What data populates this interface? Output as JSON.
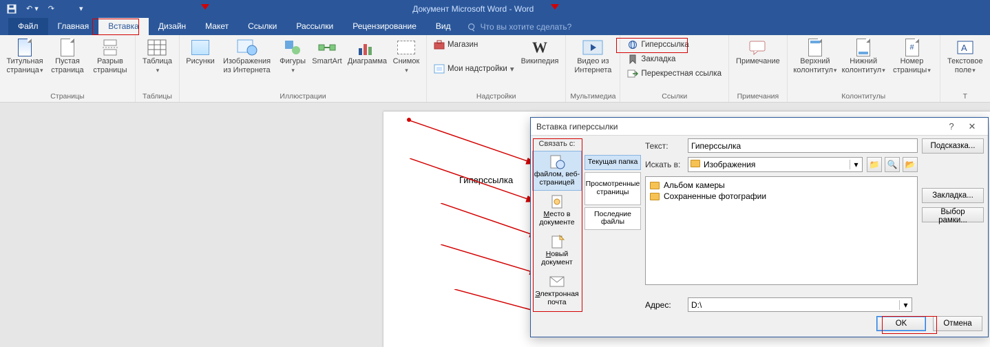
{
  "title": "Документ Microsoft Word - Word",
  "tabs": {
    "file": "Файл",
    "home": "Главная",
    "insert": "Вставка",
    "design": "Дизайн",
    "layout": "Макет",
    "references": "Ссылки",
    "mailings": "Рассылки",
    "review": "Рецензирование",
    "view": "Вид",
    "tellme": "Что вы хотите сделать?"
  },
  "ribbon": {
    "pages": {
      "label": "Страницы",
      "cover": "Титульная страница",
      "blank": "Пустая страница",
      "break": "Разрыв страницы"
    },
    "tables": {
      "label": "Таблицы",
      "table": "Таблица"
    },
    "illustrations": {
      "label": "Иллюстрации",
      "pictures": "Рисунки",
      "online": "Изображения из Интернета",
      "shapes": "Фигуры",
      "smartart": "SmartArt",
      "chart": "Диаграмма",
      "screenshot": "Снимок"
    },
    "addins": {
      "label": "Надстройки",
      "store": "Магазин",
      "myaddins": "Мои надстройки",
      "wikipedia": "Википедия"
    },
    "media": {
      "label": "Мультимедиа",
      "video": "Видео из Интернета"
    },
    "links": {
      "label": "Ссылки",
      "hyperlink": "Гиперссылка",
      "bookmark": "Закладка",
      "crossref": "Перекрестная ссылка"
    },
    "comments": {
      "label": "Примечания",
      "comment": "Примечание"
    },
    "headerfooter": {
      "label": "Колонтитулы",
      "header": "Верхний колонтитул",
      "footer": "Нижний колонтитул",
      "pagenum": "Номер страницы"
    },
    "text": {
      "label": "",
      "textbox": "Текстовое поле"
    }
  },
  "doc": {
    "text": "Гиперссылка"
  },
  "dialog": {
    "title": "Вставка гиперссылки",
    "link_to": "Связать с:",
    "opts": {
      "file": "файлом, веб-страницей",
      "place": "Место в документе",
      "newdoc": "Новый документ",
      "email": "Электронная почта"
    },
    "text_label": "Текст:",
    "text_value": "Гиперссылка",
    "lookin_label": "Искать в:",
    "lookin_value": "Изображения",
    "browse": {
      "current": "Текущая папка",
      "browsed": "Просмотренные страницы",
      "recent": "Последние файлы"
    },
    "folders": {
      "a": "Альбом камеры",
      "b": "Сохраненные фотографии"
    },
    "address_label": "Адрес:",
    "address_value": "D:\\",
    "btn_screentip": "Подсказка...",
    "btn_bookmark": "Закладка...",
    "btn_target": "Выбор рамки...",
    "ok": "OK",
    "cancel": "Отмена"
  }
}
